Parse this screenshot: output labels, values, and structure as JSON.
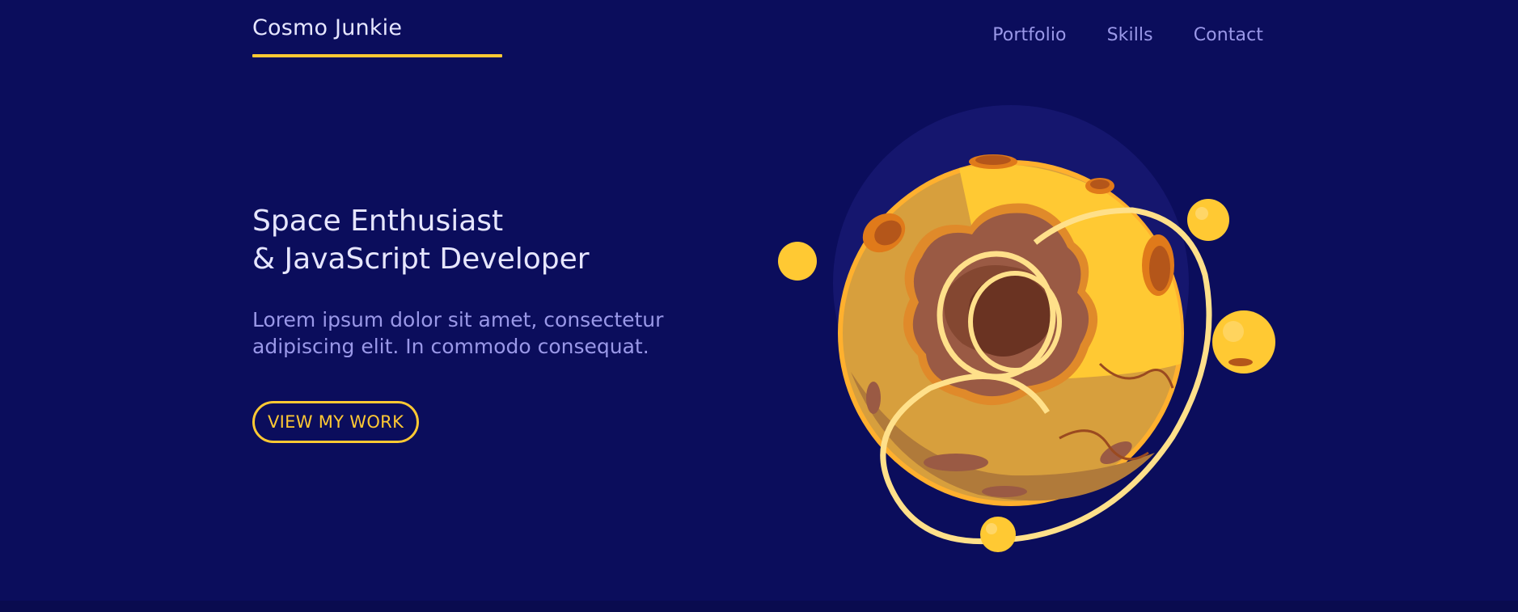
{
  "header": {
    "brand": "Cosmo Junkie",
    "nav": [
      "Portfolio",
      "Skills",
      "Contact"
    ]
  },
  "hero": {
    "title_line1": "Space Enthusiast",
    "title_line2": "& JavaScript Developer",
    "description": "Lorem ipsum dolor sit amet, consectetur adipiscing elit. In commodo consequat.",
    "cta": "VIEW MY WORK"
  },
  "colors": {
    "background": "#0b0d5c",
    "accent": "#ffc933",
    "nav_text": "#9a98e8",
    "heading_text": "#e6e6ff"
  },
  "illustration": {
    "icon": "planet-with-orbiting-moons-illustration"
  }
}
